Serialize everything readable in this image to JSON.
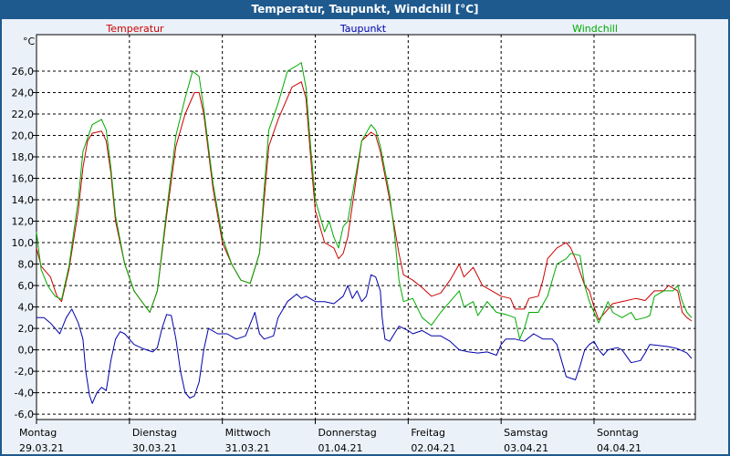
{
  "window": {
    "title": "Temperatur, Taupunkt, Windchill [°C]"
  },
  "chart_data": {
    "type": "line",
    "title": "Temperatur, Taupunkt, Windchill [°C]",
    "ylabel": "°C",
    "ylim": [
      -6.5,
      29.4
    ],
    "yticks": [
      -6,
      -4,
      -2,
      0,
      2,
      4,
      6,
      8,
      10,
      12,
      14,
      16,
      18,
      20,
      22,
      24,
      26
    ],
    "ytick_labels": [
      "-6,0",
      "-4,0",
      "-2,0",
      "0,0",
      "2,0",
      "4,0",
      "6,0",
      "8,0",
      "10,0",
      "12,0",
      "14,0",
      "16,0",
      "18,0",
      "20,0",
      "22,0",
      "24,0",
      "26,0"
    ],
    "grid": true,
    "legend_placement": "top",
    "x_unit": "days since 29.03.21 00:00",
    "xlim": [
      0,
      7.09
    ],
    "days": [
      {
        "weekday": "Montag",
        "date": "29.03.21"
      },
      {
        "weekday": "Dienstag",
        "date": "30.03.21"
      },
      {
        "weekday": "Mittwoch",
        "date": "31.03.21"
      },
      {
        "weekday": "Donnerstag",
        "date": "01.04.21"
      },
      {
        "weekday": "Freitag",
        "date": "02.04.21"
      },
      {
        "weekday": "Samstag",
        "date": "03.04.21"
      },
      {
        "weekday": "Sonntag",
        "date": "04.04.21"
      }
    ],
    "series": [
      {
        "name": "Temperatur",
        "color": "#cc0000",
        "points": [
          [
            0,
            9.5
          ],
          [
            0.05,
            7.8
          ],
          [
            0.15,
            6.8
          ],
          [
            0.22,
            5.0
          ],
          [
            0.27,
            4.5
          ],
          [
            0.35,
            7.5
          ],
          [
            0.45,
            13.0
          ],
          [
            0.5,
            17.0
          ],
          [
            0.55,
            19.5
          ],
          [
            0.6,
            20.2
          ],
          [
            0.7,
            20.4
          ],
          [
            0.75,
            19.5
          ],
          [
            0.8,
            16.5
          ],
          [
            0.85,
            12.0
          ],
          [
            0.95,
            8.0
          ],
          [
            1.05,
            5.5
          ],
          [
            1.15,
            4.3
          ],
          [
            1.22,
            3.5
          ],
          [
            1.3,
            5.5
          ],
          [
            1.4,
            12.5
          ],
          [
            1.5,
            19.0
          ],
          [
            1.6,
            22.0
          ],
          [
            1.7,
            24.0
          ],
          [
            1.75,
            24.0
          ],
          [
            1.8,
            22.0
          ],
          [
            1.9,
            15.0
          ],
          [
            2.0,
            10.0
          ],
          [
            2.1,
            8.0
          ],
          [
            2.2,
            6.5
          ],
          [
            2.3,
            6.2
          ],
          [
            2.4,
            9.0
          ],
          [
            2.45,
            14.0
          ],
          [
            2.5,
            19.0
          ],
          [
            2.6,
            21.5
          ],
          [
            2.75,
            24.5
          ],
          [
            2.85,
            25.0
          ],
          [
            2.9,
            23.5
          ],
          [
            2.95,
            18.0
          ],
          [
            3.0,
            13.0
          ],
          [
            3.1,
            10.0
          ],
          [
            3.2,
            9.5
          ],
          [
            3.25,
            8.5
          ],
          [
            3.3,
            9.0
          ],
          [
            3.35,
            10.5
          ],
          [
            3.45,
            16.5
          ],
          [
            3.5,
            19.5
          ],
          [
            3.6,
            20.3
          ],
          [
            3.65,
            20.0
          ],
          [
            3.7,
            18.5
          ],
          [
            3.8,
            14.0
          ],
          [
            3.9,
            9.0
          ],
          [
            3.95,
            7.0
          ],
          [
            4.05,
            6.5
          ],
          [
            4.15,
            5.8
          ],
          [
            4.25,
            5.0
          ],
          [
            4.35,
            5.3
          ],
          [
            4.45,
            6.5
          ],
          [
            4.55,
            8.0
          ],
          [
            4.6,
            6.8
          ],
          [
            4.7,
            7.7
          ],
          [
            4.8,
            6.0
          ],
          [
            4.9,
            5.5
          ],
          [
            5.0,
            5.0
          ],
          [
            5.1,
            4.8
          ],
          [
            5.15,
            3.8
          ],
          [
            5.25,
            3.8
          ],
          [
            5.3,
            4.8
          ],
          [
            5.4,
            5.0
          ],
          [
            5.45,
            6.5
          ],
          [
            5.5,
            8.5
          ],
          [
            5.6,
            9.5
          ],
          [
            5.7,
            10.0
          ],
          [
            5.75,
            9.5
          ],
          [
            5.8,
            8.5
          ],
          [
            5.9,
            6.0
          ],
          [
            5.95,
            5.5
          ],
          [
            6.0,
            4.0
          ],
          [
            6.05,
            2.8
          ],
          [
            6.15,
            3.8
          ],
          [
            6.2,
            4.3
          ],
          [
            6.3,
            4.5
          ],
          [
            6.45,
            4.8
          ],
          [
            6.55,
            4.6
          ],
          [
            6.65,
            5.5
          ],
          [
            6.75,
            5.5
          ],
          [
            6.8,
            6.0
          ],
          [
            6.9,
            5.5
          ],
          [
            6.95,
            3.5
          ],
          [
            7.0,
            3.0
          ],
          [
            7.05,
            2.7
          ]
        ]
      },
      {
        "name": "Taupunkt",
        "color": "#0000aa",
        "points": [
          [
            0,
            3.0
          ],
          [
            0.08,
            3.0
          ],
          [
            0.15,
            2.5
          ],
          [
            0.25,
            1.5
          ],
          [
            0.32,
            3.0
          ],
          [
            0.38,
            3.8
          ],
          [
            0.45,
            2.5
          ],
          [
            0.5,
            1.0
          ],
          [
            0.53,
            -2.0
          ],
          [
            0.57,
            -4.2
          ],
          [
            0.6,
            -5.0
          ],
          [
            0.65,
            -4.0
          ],
          [
            0.7,
            -3.5
          ],
          [
            0.75,
            -3.8
          ],
          [
            0.8,
            -1.0
          ],
          [
            0.85,
            1.0
          ],
          [
            0.9,
            1.7
          ],
          [
            0.95,
            1.5
          ],
          [
            1.05,
            0.5
          ],
          [
            1.15,
            0.1
          ],
          [
            1.25,
            -0.2
          ],
          [
            1.3,
            0.2
          ],
          [
            1.35,
            2.0
          ],
          [
            1.4,
            3.3
          ],
          [
            1.45,
            3.2
          ],
          [
            1.5,
            1.0
          ],
          [
            1.55,
            -2.0
          ],
          [
            1.6,
            -4.0
          ],
          [
            1.65,
            -4.5
          ],
          [
            1.7,
            -4.3
          ],
          [
            1.75,
            -3.0
          ],
          [
            1.8,
            0.0
          ],
          [
            1.85,
            2.0
          ],
          [
            1.95,
            1.5
          ],
          [
            2.05,
            1.5
          ],
          [
            2.15,
            1.0
          ],
          [
            2.25,
            1.3
          ],
          [
            2.35,
            3.5
          ],
          [
            2.4,
            1.5
          ],
          [
            2.45,
            1.0
          ],
          [
            2.55,
            1.3
          ],
          [
            2.6,
            3.0
          ],
          [
            2.7,
            4.5
          ],
          [
            2.8,
            5.2
          ],
          [
            2.85,
            4.8
          ],
          [
            2.9,
            5.0
          ],
          [
            3.0,
            4.5
          ],
          [
            3.1,
            4.5
          ],
          [
            3.2,
            4.3
          ],
          [
            3.3,
            5.0
          ],
          [
            3.35,
            6.0
          ],
          [
            3.4,
            4.8
          ],
          [
            3.45,
            5.5
          ],
          [
            3.5,
            4.5
          ],
          [
            3.55,
            5.0
          ],
          [
            3.6,
            7.0
          ],
          [
            3.65,
            6.8
          ],
          [
            3.7,
            5.5
          ],
          [
            3.72,
            3.0
          ],
          [
            3.75,
            1.0
          ],
          [
            3.8,
            0.8
          ],
          [
            3.85,
            1.5
          ],
          [
            3.9,
            2.2
          ],
          [
            4.0,
            1.8
          ],
          [
            4.05,
            1.5
          ],
          [
            4.15,
            1.8
          ],
          [
            4.25,
            1.3
          ],
          [
            4.35,
            1.3
          ],
          [
            4.45,
            0.8
          ],
          [
            4.55,
            0.0
          ],
          [
            4.65,
            -0.2
          ],
          [
            4.75,
            -0.3
          ],
          [
            4.85,
            -0.2
          ],
          [
            4.95,
            -0.5
          ],
          [
            5.0,
            0.5
          ],
          [
            5.05,
            1.0
          ],
          [
            5.15,
            1.0
          ],
          [
            5.25,
            0.8
          ],
          [
            5.35,
            1.5
          ],
          [
            5.45,
            1.0
          ],
          [
            5.55,
            1.0
          ],
          [
            5.6,
            0.5
          ],
          [
            5.65,
            -1.0
          ],
          [
            5.7,
            -2.5
          ],
          [
            5.8,
            -2.8
          ],
          [
            5.85,
            -1.5
          ],
          [
            5.9,
            0.0
          ],
          [
            5.95,
            0.5
          ],
          [
            6.0,
            0.8
          ],
          [
            6.05,
            0.0
          ],
          [
            6.1,
            -0.5
          ],
          [
            6.15,
            0.0
          ],
          [
            6.25,
            0.2
          ],
          [
            6.3,
            0.0
          ],
          [
            6.4,
            -1.2
          ],
          [
            6.5,
            -1.0
          ],
          [
            6.55,
            -0.3
          ],
          [
            6.6,
            0.5
          ],
          [
            6.7,
            0.4
          ],
          [
            6.8,
            0.3
          ],
          [
            6.9,
            0.1
          ],
          [
            7.0,
            -0.3
          ],
          [
            7.05,
            -0.8
          ]
        ]
      },
      {
        "name": "Windchill",
        "color": "#00aa00",
        "points": [
          [
            0,
            11.0
          ],
          [
            0.05,
            7.5
          ],
          [
            0.12,
            6.0
          ],
          [
            0.2,
            5.0
          ],
          [
            0.27,
            4.7
          ],
          [
            0.35,
            7.8
          ],
          [
            0.45,
            14.0
          ],
          [
            0.5,
            18.5
          ],
          [
            0.6,
            21.0
          ],
          [
            0.7,
            21.5
          ],
          [
            0.75,
            20.5
          ],
          [
            0.8,
            17.0
          ],
          [
            0.85,
            12.5
          ],
          [
            0.95,
            8.0
          ],
          [
            1.05,
            5.5
          ],
          [
            1.15,
            4.3
          ],
          [
            1.22,
            3.5
          ],
          [
            1.3,
            5.5
          ],
          [
            1.4,
            13.0
          ],
          [
            1.5,
            20.0
          ],
          [
            1.6,
            23.5
          ],
          [
            1.68,
            26.0
          ],
          [
            1.75,
            25.5
          ],
          [
            1.8,
            22.5
          ],
          [
            1.9,
            15.5
          ],
          [
            2.0,
            10.5
          ],
          [
            2.1,
            8.0
          ],
          [
            2.2,
            6.5
          ],
          [
            2.3,
            6.2
          ],
          [
            2.4,
            9.0
          ],
          [
            2.45,
            15.0
          ],
          [
            2.5,
            20.5
          ],
          [
            2.6,
            23.0
          ],
          [
            2.7,
            26.0
          ],
          [
            2.8,
            26.5
          ],
          [
            2.85,
            26.8
          ],
          [
            2.9,
            24.5
          ],
          [
            2.95,
            19.0
          ],
          [
            3.0,
            14.0
          ],
          [
            3.1,
            11.0
          ],
          [
            3.15,
            12.0
          ],
          [
            3.2,
            10.5
          ],
          [
            3.25,
            9.5
          ],
          [
            3.3,
            11.5
          ],
          [
            3.35,
            12.0
          ],
          [
            3.45,
            17.0
          ],
          [
            3.5,
            19.5
          ],
          [
            3.6,
            21.0
          ],
          [
            3.65,
            20.5
          ],
          [
            3.7,
            19.0
          ],
          [
            3.8,
            14.5
          ],
          [
            3.85,
            11.0
          ],
          [
            3.9,
            6.5
          ],
          [
            3.95,
            4.5
          ],
          [
            4.05,
            4.8
          ],
          [
            4.15,
            3.0
          ],
          [
            4.25,
            2.3
          ],
          [
            4.35,
            3.5
          ],
          [
            4.45,
            4.5
          ],
          [
            4.55,
            5.5
          ],
          [
            4.6,
            4.0
          ],
          [
            4.7,
            4.5
          ],
          [
            4.75,
            3.2
          ],
          [
            4.85,
            4.5
          ],
          [
            4.95,
            3.5
          ],
          [
            5.05,
            3.3
          ],
          [
            5.15,
            3.0
          ],
          [
            5.2,
            1.0
          ],
          [
            5.25,
            2.0
          ],
          [
            5.3,
            3.5
          ],
          [
            5.4,
            3.5
          ],
          [
            5.5,
            5.0
          ],
          [
            5.6,
            8.0
          ],
          [
            5.7,
            8.5
          ],
          [
            5.75,
            9.0
          ],
          [
            5.85,
            8.8
          ],
          [
            5.9,
            6.0
          ],
          [
            5.95,
            4.5
          ],
          [
            6.05,
            2.5
          ],
          [
            6.1,
            3.5
          ],
          [
            6.15,
            4.5
          ],
          [
            6.2,
            3.5
          ],
          [
            6.3,
            3.0
          ],
          [
            6.4,
            3.5
          ],
          [
            6.45,
            2.8
          ],
          [
            6.55,
            3.0
          ],
          [
            6.6,
            3.2
          ],
          [
            6.65,
            5.0
          ],
          [
            6.75,
            5.5
          ],
          [
            6.85,
            5.5
          ],
          [
            6.9,
            6.0
          ],
          [
            6.95,
            4.5
          ],
          [
            7.0,
            3.5
          ],
          [
            7.05,
            3.0
          ]
        ]
      }
    ]
  }
}
